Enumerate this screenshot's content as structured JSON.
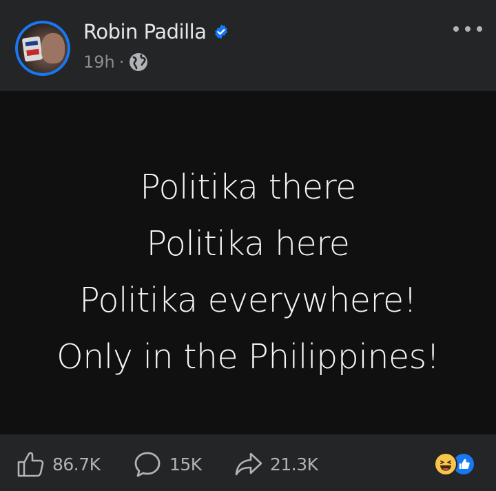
{
  "post": {
    "author": "Robin Padilla",
    "verified": true,
    "timestamp": "19h",
    "separator": "·",
    "audience_icon": "globe-icon",
    "more_icon": "more-options-icon",
    "lines": [
      "Politika there",
      "Politika here",
      "Politika everywhere!",
      "Only in the Philippines!"
    ]
  },
  "stats": {
    "likes": "86.7K",
    "comments": "15K",
    "shares": "21.3K"
  },
  "reactions": [
    "haha-reaction-icon",
    "like-reaction-icon"
  ],
  "colors": {
    "background": "#242526",
    "post_background": "#101010",
    "verified": "#1877f2",
    "text": "#e4e6eb",
    "muted": "#b0b3b8"
  }
}
